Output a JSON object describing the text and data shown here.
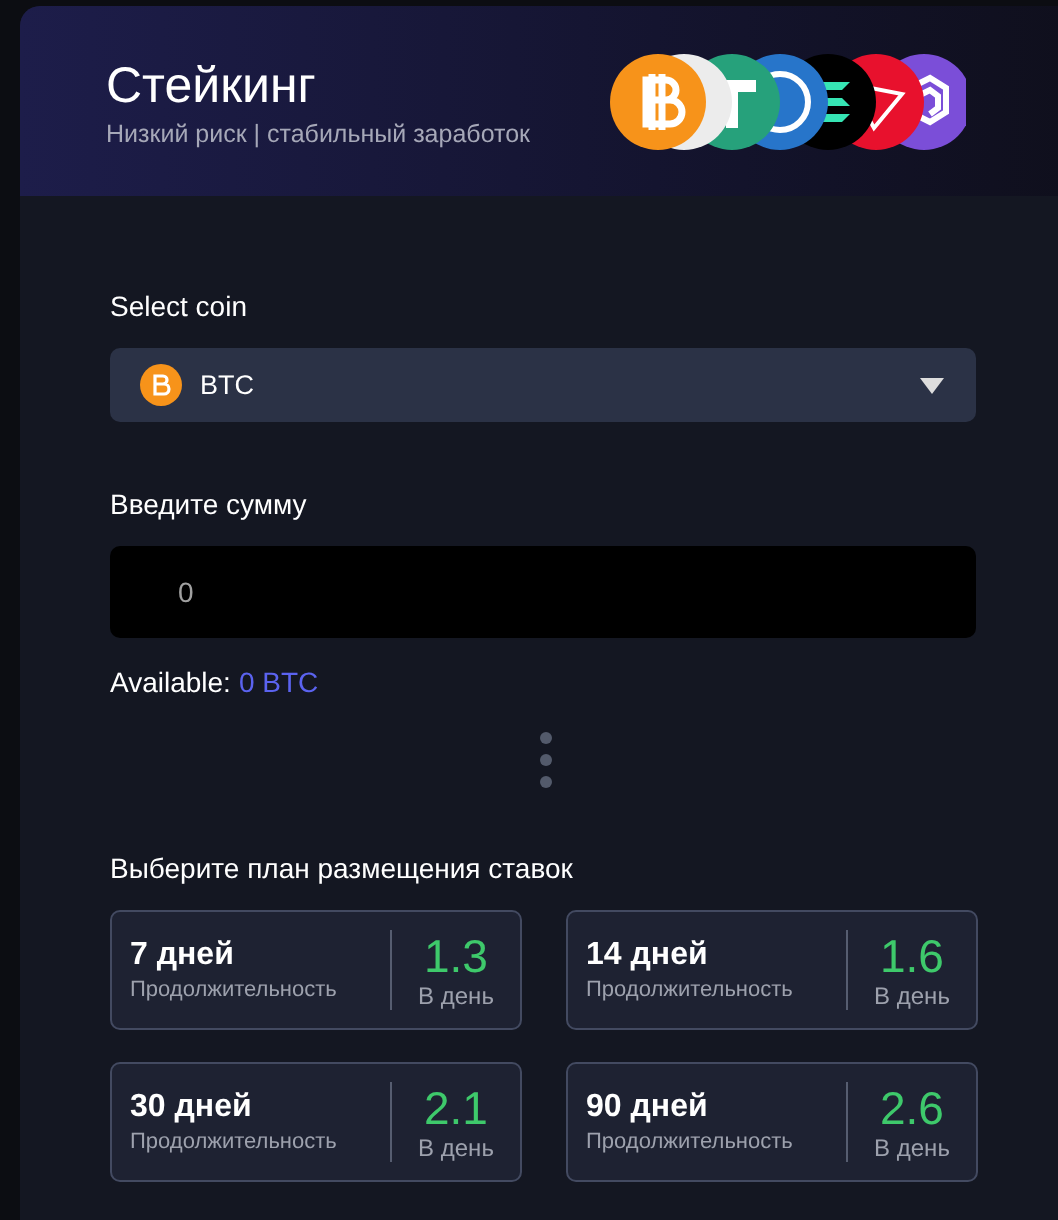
{
  "header": {
    "title": "Стейкинг",
    "subtitle": "Низкий риск | стабильный заработок"
  },
  "coin_select": {
    "label": "Select coin",
    "value": "BTC"
  },
  "amount": {
    "label": "Введите сумму",
    "value": "0"
  },
  "available": {
    "label": "Available:",
    "value": "0 BTC"
  },
  "plans": {
    "heading": "Выберите план размещения ставок",
    "items": [
      {
        "duration": "7 дней",
        "duration_caption": "Продолжительность",
        "rate": "1.3",
        "rate_caption": "В день"
      },
      {
        "duration": "14 дней",
        "duration_caption": "Продолжительность",
        "rate": "1.6",
        "rate_caption": "В день"
      },
      {
        "duration": "30 дней",
        "duration_caption": "Продолжительность",
        "rate": "2.1",
        "rate_caption": "В день"
      },
      {
        "duration": "90 дней",
        "duration_caption": "Продолжительность",
        "rate": "2.6",
        "rate_caption": "В день"
      }
    ]
  }
}
